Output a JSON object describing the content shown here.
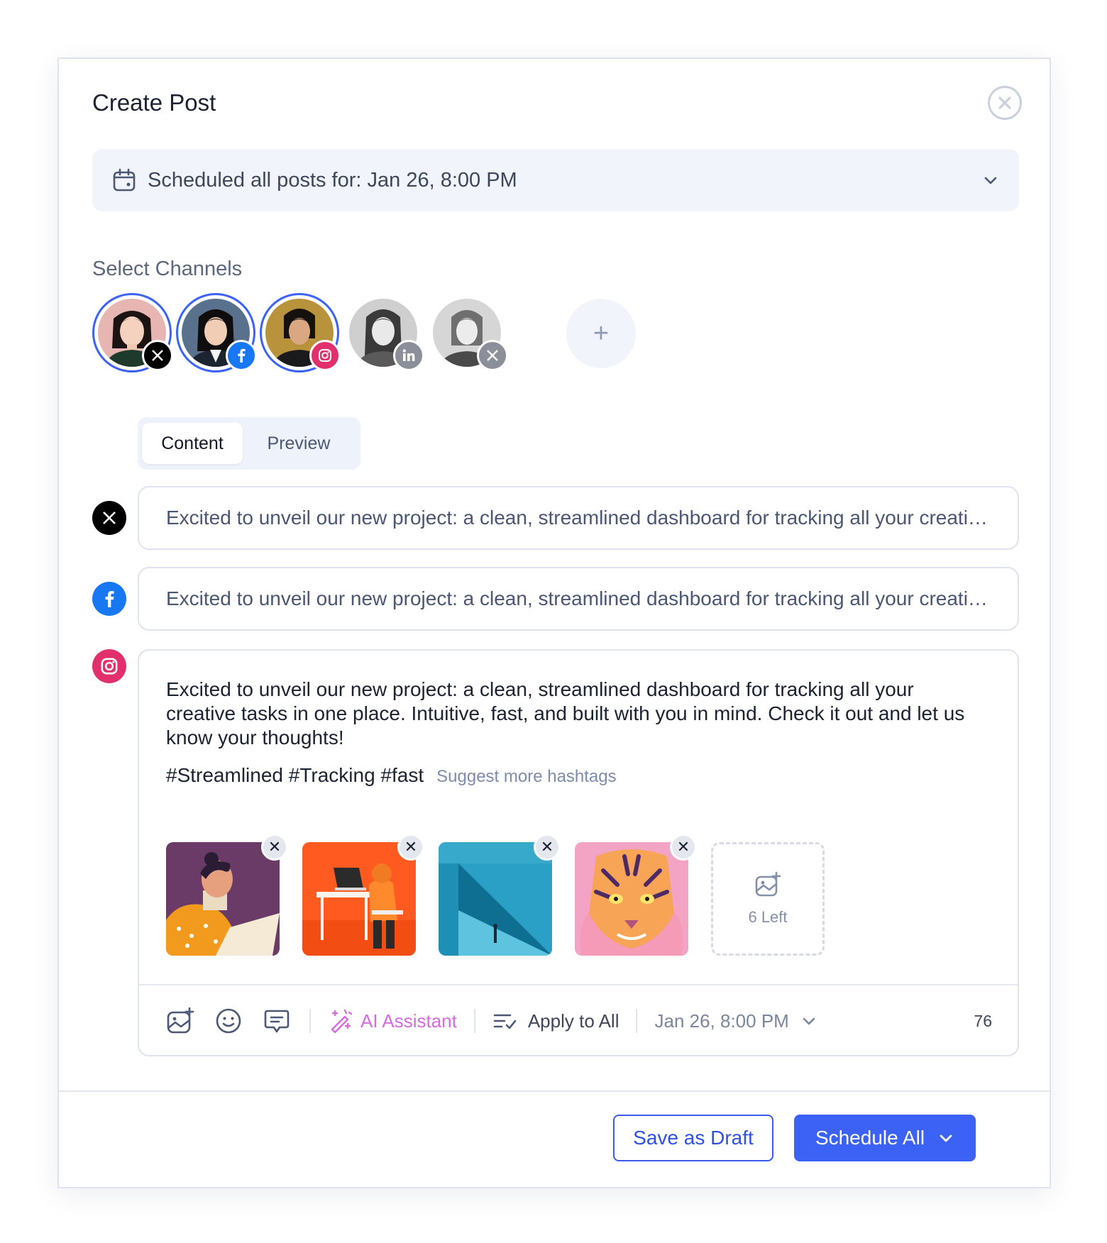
{
  "modal": {
    "title": "Create Post",
    "close_icon": "close-circle-icon"
  },
  "schedule": {
    "icon": "calendar-icon",
    "text": "Scheduled all posts for: Jan 26, 8:00 PM"
  },
  "channels": {
    "label": "Select Channels",
    "items": [
      {
        "network": "x",
        "selected": true
      },
      {
        "network": "facebook",
        "selected": true
      },
      {
        "network": "instagram",
        "selected": true
      },
      {
        "network": "linkedin",
        "selected": false
      },
      {
        "network": "x",
        "selected": false
      }
    ],
    "add_label": "+"
  },
  "tabs": [
    {
      "label": "Content",
      "active": true
    },
    {
      "label": "Preview",
      "active": false
    }
  ],
  "posts": {
    "x": {
      "text": "Excited to unveil our new project: a clean, streamlined dashboard for tracking all your creative tasks in one place."
    },
    "facebook": {
      "text": "Excited to unveil our new project: a clean, streamlined dashboard for tracking all your creative tasks in one place."
    },
    "instagram": {
      "text": "Excited to unveil our new project: a clean, streamlined dashboard for tracking all your creative tasks in one place. Intuitive, fast, and built with you in mind. Check it out and let us know your thoughts!",
      "hashtags": "#Streamlined #Tracking #fast",
      "suggest_label": "Suggest more hashtags",
      "media_left": "6 Left",
      "toolbar": {
        "ai_label": "AI Assistant",
        "apply_label": "Apply to All",
        "date_label": "Jan 26, 8:00 PM",
        "char_count": "76"
      }
    }
  },
  "footer": {
    "draft_label": "Save as Draft",
    "schedule_label": "Schedule All"
  },
  "colors": {
    "primary": "#3b62f5",
    "instagram": "#e1306c",
    "facebook": "#1877f2",
    "ai": "#d66be0"
  }
}
